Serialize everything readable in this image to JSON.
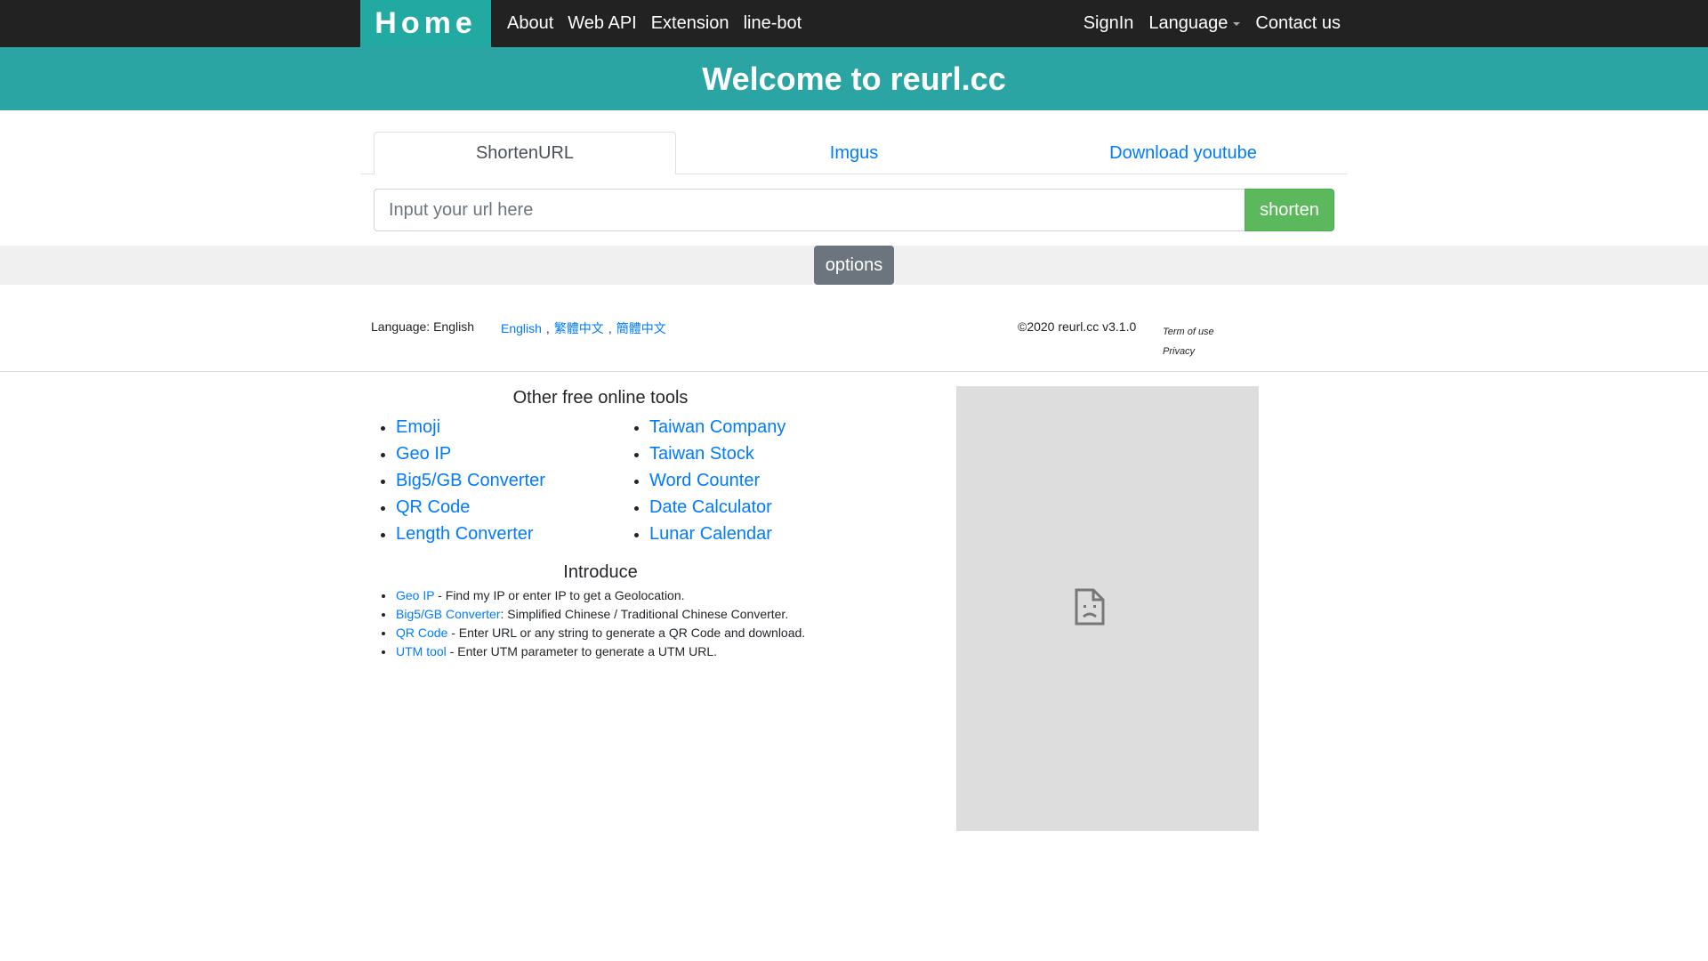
{
  "navbar": {
    "brand": "Home",
    "left_links": [
      "About",
      "Web API",
      "Extension",
      "line-bot"
    ],
    "signin": "SignIn",
    "language": "Language",
    "contact": "Contact us"
  },
  "banner": {
    "title": "Welcome to reurl.cc"
  },
  "tabs": [
    "ShortenURL",
    "Imgus",
    "Download youtube"
  ],
  "shorten_form": {
    "placeholder": "Input your url here",
    "value": "",
    "button": "shorten"
  },
  "options": {
    "label": "options"
  },
  "footer": {
    "language_label": "Language: English",
    "languages": [
      "English",
      "繁體中文",
      "簡體中文"
    ],
    "separator": ",",
    "copyright": "©2020 reurl.cc v3.1.0",
    "term_of_use": "Term of use",
    "privacy": "Privacy"
  },
  "tools": {
    "title": "Other free online tools",
    "column1": [
      "Emoji",
      "Geo IP",
      "Big5/GB Converter",
      "QR Code",
      "Length Converter"
    ],
    "column2": [
      "Taiwan Company",
      "Taiwan Stock",
      "Word Counter",
      "Date Calculator",
      "Lunar Calendar"
    ]
  },
  "introduce": {
    "title": "Introduce",
    "items": [
      {
        "link": "Geo IP",
        "text": " - Find my IP or enter IP to get a Geolocation."
      },
      {
        "link": "Big5/GB Converter",
        "text": ": Simplified Chinese / Traditional Chinese Converter."
      },
      {
        "link": "QR Code",
        "text": " - Enter URL or any string to generate a QR Code and download."
      },
      {
        "link": "UTM tool",
        "text": " - Enter UTM parameter to generate a UTM URL."
      }
    ]
  },
  "ad": {
    "icon": "broken-document-icon"
  },
  "colors": {
    "navbar_bg": "#222222",
    "brand_bg": "#21a9a2",
    "banner_bg": "#2aa5a3",
    "link": "#007bff",
    "shorten_button": "#5cb85c",
    "options_button": "#6c757d"
  }
}
